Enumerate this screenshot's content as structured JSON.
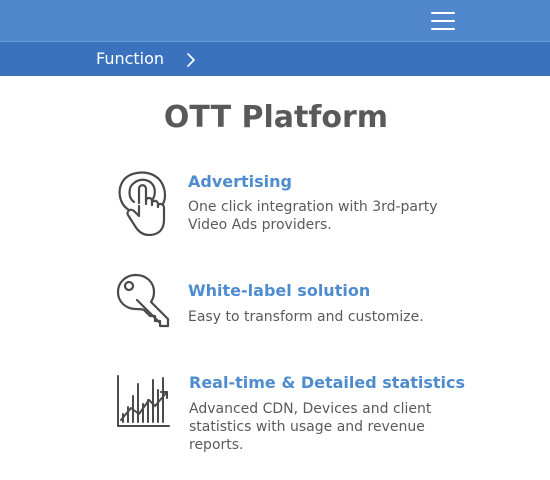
{
  "header": {
    "menu_icon": "hamburger-menu-icon",
    "background": "#5187cd"
  },
  "breadcrumb": {
    "label": "Function",
    "chevron_icon": "chevron-right-icon",
    "background": "#3a72bd"
  },
  "page": {
    "title": "OTT Platform"
  },
  "features": [
    {
      "icon": "touch-hand-icon",
      "title": "Advertising",
      "description": "One click integration with 3rd-party Video Ads providers."
    },
    {
      "icon": "key-icon",
      "title": "White-label solution",
      "description": "Easy to transform and customize."
    },
    {
      "icon": "statistics-chart-icon",
      "title": "Real-time & Detailed statistics",
      "description": "Advanced CDN, Devices and client statistics with usage and revenue reports."
    }
  ],
  "colors": {
    "accent": "#4f8ccf",
    "title_text": "#595959",
    "body_text": "#5a5a5a"
  }
}
